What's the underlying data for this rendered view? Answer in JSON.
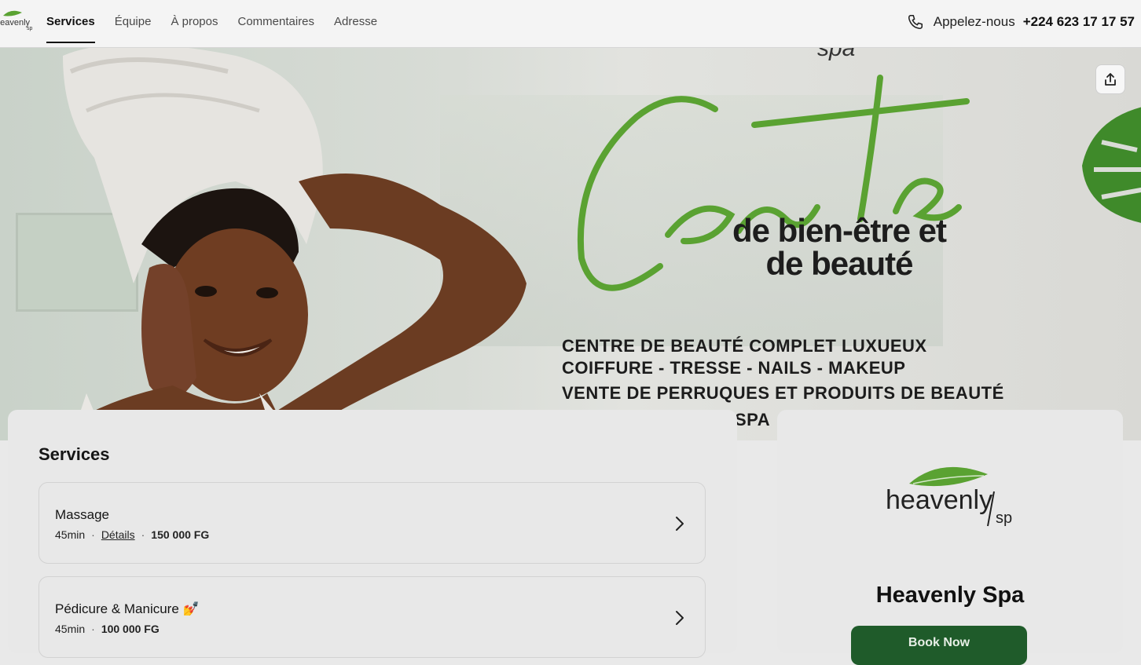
{
  "nav": {
    "tabs": [
      {
        "label": "Services",
        "active": true
      },
      {
        "label": "Équipe"
      },
      {
        "label": "À propos"
      },
      {
        "label": "Commentaires"
      },
      {
        "label": "Adresse"
      }
    ],
    "call_label": "Appelez-nous",
    "phone": "+224 623 17 17 57"
  },
  "hero": {
    "spa_mark": "spa",
    "script_word": "Centre",
    "subtitle_line1": "de bien-être et",
    "subtitle_line2": "de beauté",
    "lines": [
      "CENTRE DE BEAUTÉ COMPLET LUXUEUX",
      "COIFFURE - TRESSE - NAILS - MAKEUP",
      "VENTE DE PERRUQUES ET PRODUITS DE BEAUTÉ",
      "SPA"
    ]
  },
  "services": {
    "title": "Services",
    "items": [
      {
        "name": "Massage",
        "duration": "45min",
        "details": "Détails",
        "price": "150 000 FG"
      },
      {
        "name": "Pédicure & Manicure 💅",
        "duration": "45min",
        "price": "100 000 FG"
      }
    ]
  },
  "business": {
    "logo_text": "heavenly spa",
    "name": "Heavenly Spa",
    "book_label": "Book Now"
  },
  "colors": {
    "accent_green": "#5aa232",
    "button_green": "#1f5b2a"
  }
}
